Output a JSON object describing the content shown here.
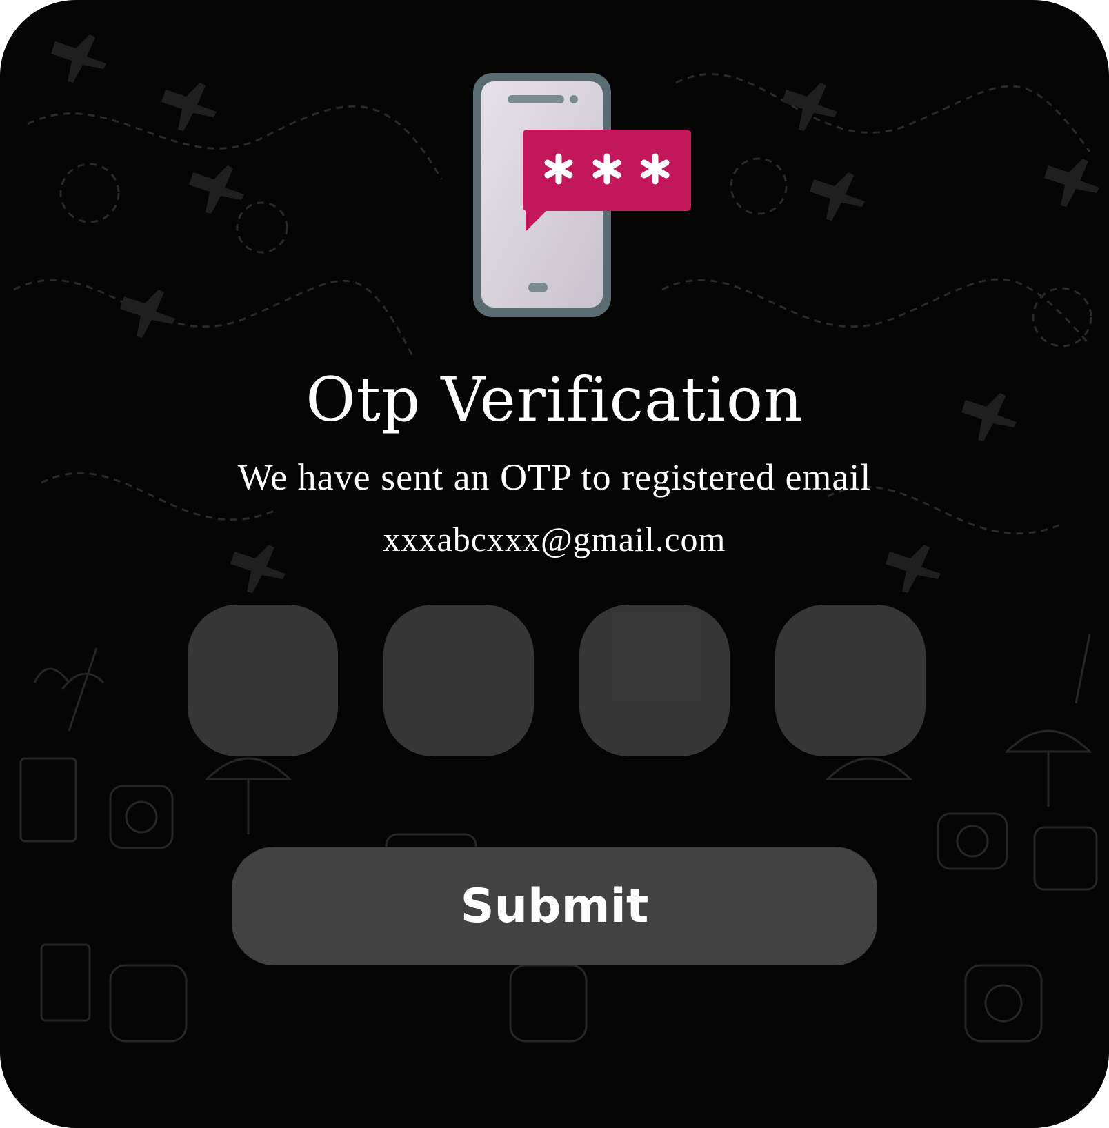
{
  "otp_verification": {
    "title": "Otp Verification",
    "subtitle": "We have sent an OTP to registered email",
    "email": "xxxabcxxx@gmail.com",
    "otp_inputs": [
      {
        "value": ""
      },
      {
        "value": ""
      },
      {
        "value": ""
      },
      {
        "value": ""
      }
    ],
    "submit_label": "Submit",
    "illustration": {
      "icon": "phone-otp-message-icon",
      "message_text": "***",
      "accent_color": "#c2185b"
    }
  },
  "colors": {
    "background": "#050505",
    "input_fill": "#424242",
    "button_fill": "#424242",
    "text": "#ffffff"
  }
}
